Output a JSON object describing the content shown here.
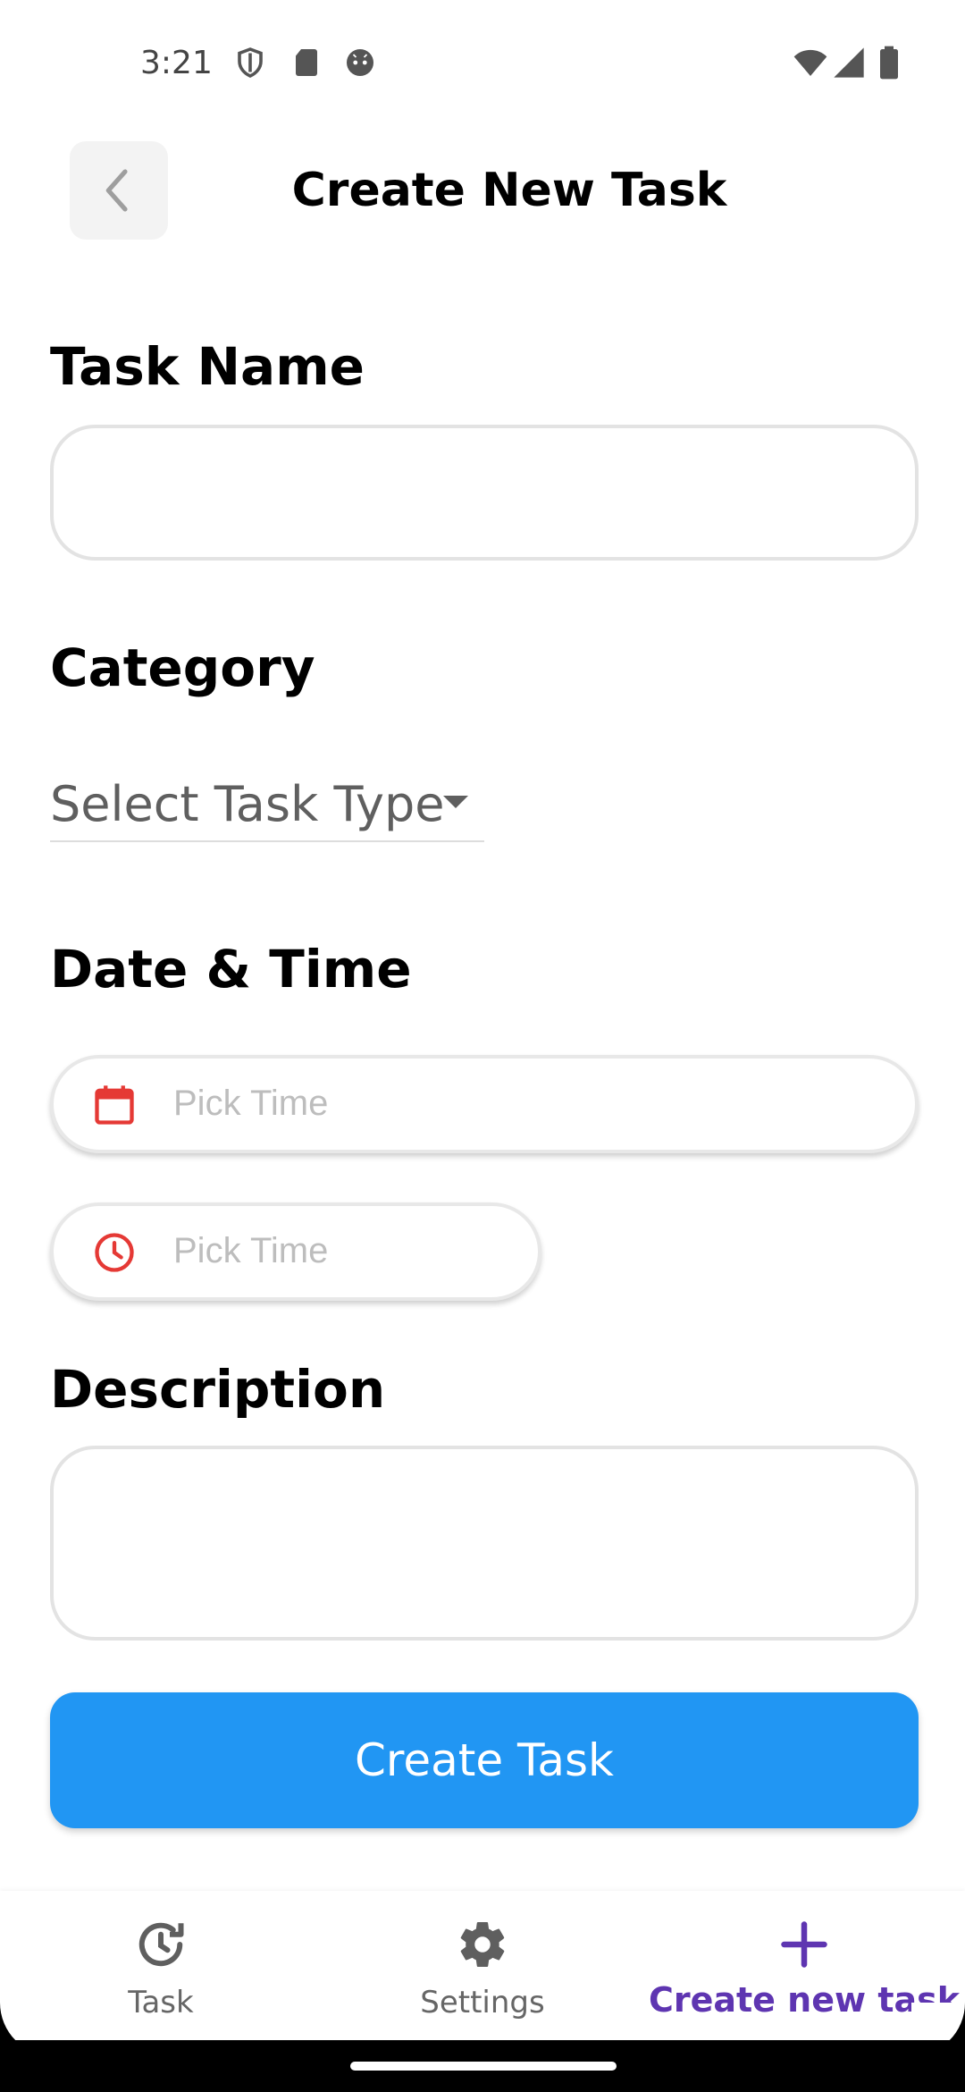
{
  "status_bar": {
    "time": "3:21",
    "icons_left": [
      "shield-icon",
      "sd-card-icon",
      "android-face-icon"
    ],
    "icons_right": [
      "wifi-icon",
      "signal-icon",
      "battery-icon"
    ]
  },
  "app_bar": {
    "back_icon": "chevron-left-icon",
    "title": "Create New Task"
  },
  "form": {
    "task_name_label": "Task Name",
    "task_name_value": "",
    "category_label": "Category",
    "category_selected": "Select Task Type",
    "date_time_label": "Date & Time",
    "date_placeholder": "Pick Time",
    "time_placeholder": "Pick Time",
    "description_label": "Description",
    "description_value": "",
    "submit_label": "Create Task"
  },
  "bottom_nav": {
    "items": [
      {
        "label": "Task",
        "icon": "history-clock-icon",
        "active": false
      },
      {
        "label": "Settings",
        "icon": "gear-icon",
        "active": false
      },
      {
        "label": "Create new task",
        "icon": "plus-icon",
        "active": true
      }
    ]
  },
  "colors": {
    "primary_button": "#2196f3",
    "active_nav": "#5e35b1",
    "picker_icon": "#e53935"
  }
}
